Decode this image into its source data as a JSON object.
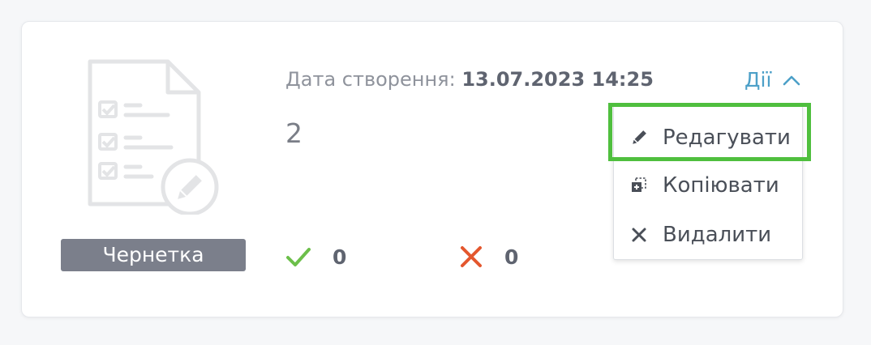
{
  "card": {
    "status_badge": "Чернетка",
    "date_label": "Дата створення:",
    "date_value": "13.07.2023 14:25",
    "number": "2",
    "approved_count": "0",
    "rejected_count": "0"
  },
  "actions": {
    "toggle_label": "Дії",
    "expanded": true,
    "menu": [
      {
        "label": "Редагувати",
        "icon": "pencil-icon",
        "highlighted": true
      },
      {
        "label": "Копіювати",
        "icon": "copy-icon"
      },
      {
        "label": "Видалити",
        "icon": "close-icon"
      }
    ]
  },
  "colors": {
    "accent": "#4da0c8",
    "badge": "#7b7f8b",
    "approved": "#6cbf4a",
    "rejected": "#e4572e",
    "highlight": "#4fbf3e"
  },
  "icons": {
    "illustration": "document-checklist-edit-icon",
    "approved": "check-icon",
    "rejected": "cross-icon",
    "toggle": "chevron-up-icon"
  }
}
